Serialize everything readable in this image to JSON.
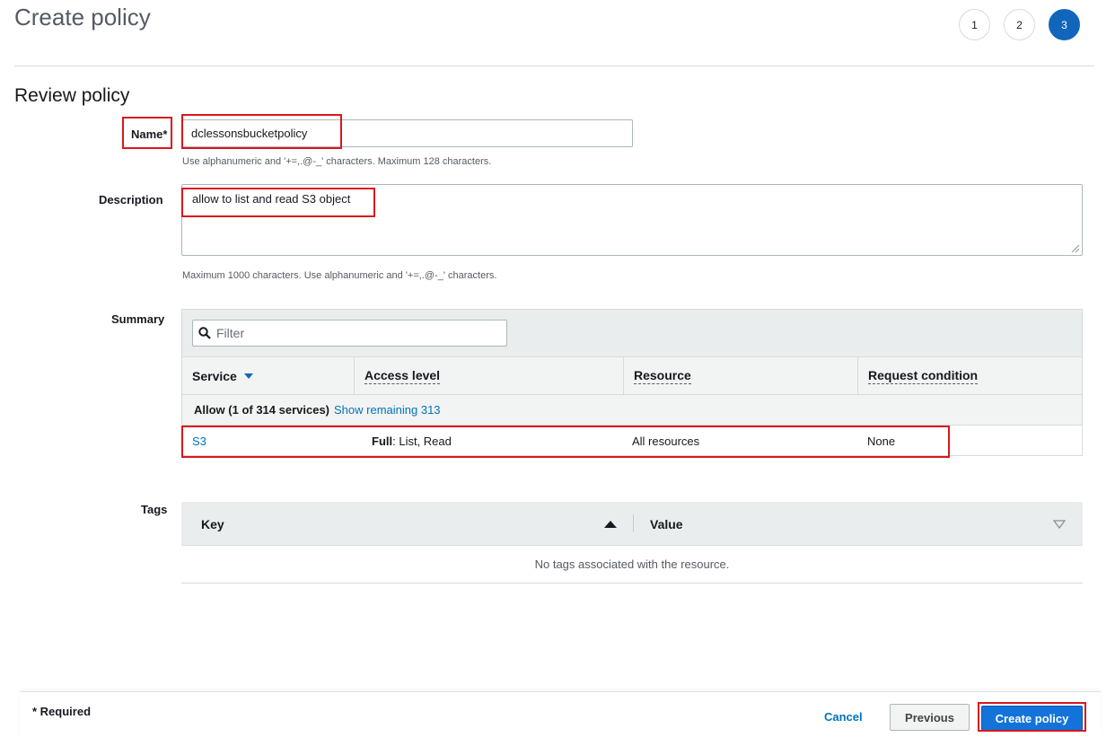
{
  "page": {
    "title": "Create policy"
  },
  "steps": [
    {
      "label": "1",
      "active": false
    },
    {
      "label": "2",
      "active": false
    },
    {
      "label": "3",
      "active": true
    }
  ],
  "review": {
    "section_title": "Review policy",
    "name": {
      "label": "Name*",
      "value": "dclessonsbucketpolicy",
      "hint": "Use alphanumeric and '+=,.@-_' characters. Maximum 128 characters."
    },
    "description": {
      "label": "Description",
      "value": "allow to list and read S3 object",
      "hint": "Maximum 1000 characters. Use alphanumeric and '+=,.@-_' characters."
    }
  },
  "summary": {
    "label": "Summary",
    "filter_placeholder": "Filter",
    "columns": [
      "Service",
      "Access level",
      "Resource",
      "Request condition"
    ],
    "group": {
      "label": "Allow (1 of 314 services)",
      "link": "Show remaining 313"
    },
    "rows": [
      {
        "service": "S3",
        "access_bold": "Full",
        "access_rest": ": List, Read",
        "resource": "All resources",
        "condition": "None"
      }
    ]
  },
  "tags": {
    "label": "Tags",
    "columns": [
      "Key",
      "Value"
    ],
    "empty_text": "No tags associated with the resource."
  },
  "footer": {
    "required_note": "* Required",
    "cancel": "Cancel",
    "previous": "Previous",
    "create": "Create policy"
  },
  "colors": {
    "accent": "#1166bb",
    "link": "#0073bb",
    "highlight": "#d9171f",
    "primary_button": "#1373d9"
  }
}
